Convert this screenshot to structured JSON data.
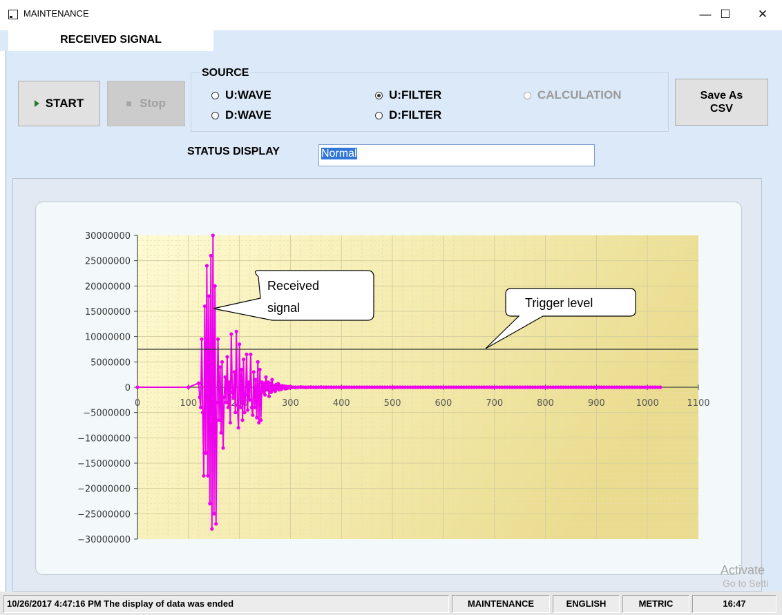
{
  "window": {
    "title": "MAINTENANCE",
    "minimize": "—",
    "maximize": "☐",
    "close": "✕"
  },
  "tabs": [
    {
      "label": "RECEIVED SIGNAL",
      "active": true
    }
  ],
  "toolbar": {
    "start_label": "START",
    "stop_label": "Stop",
    "save_line1": "Save As",
    "save_line2": "CSV"
  },
  "source": {
    "legend": "SOURCE",
    "options": [
      {
        "label": "U:WAVE",
        "checked": false,
        "enabled": true
      },
      {
        "label": "U:FILTER",
        "checked": true,
        "enabled": true
      },
      {
        "label": "CALCULATION",
        "checked": false,
        "enabled": false
      },
      {
        "label": "D:WAVE",
        "checked": false,
        "enabled": true
      },
      {
        "label": "D:FILTER",
        "checked": false,
        "enabled": true
      }
    ]
  },
  "status": {
    "label": "STATUS DISPLAY",
    "value": "Normal"
  },
  "chart_data": {
    "type": "scatter",
    "series": [
      {
        "color": "#ee00ee",
        "x": [
          0,
          100,
          120,
          122,
          124,
          126,
          128,
          130,
          132,
          134,
          136,
          138,
          140,
          142,
          144,
          146,
          148,
          150,
          152,
          154,
          156,
          158,
          160,
          162,
          164,
          166,
          168,
          170,
          172,
          174,
          176,
          178,
          180,
          182,
          184,
          186,
          188,
          190,
          192,
          194,
          196,
          198,
          200,
          202,
          204,
          206,
          208,
          210,
          212,
          214,
          216,
          218,
          220,
          222,
          224,
          226,
          228,
          230,
          232,
          234,
          236,
          238,
          240,
          242,
          244,
          246,
          248,
          250,
          252,
          254,
          256,
          258,
          260,
          262,
          264,
          266,
          268,
          270,
          272,
          274,
          276,
          278,
          280,
          282,
          284,
          286,
          288,
          290,
          292,
          294,
          296,
          298,
          300,
          310,
          320,
          330,
          340,
          350,
          360,
          370,
          380,
          390,
          400,
          410,
          500,
          1025
        ],
        "y": [
          0,
          0,
          800000,
          -2000000,
          -4000000,
          9500000,
          -5000000,
          -17500000,
          16000000,
          -13000000,
          24000000,
          -17500000,
          18000000,
          -23000000,
          26000000,
          -28000000,
          30000000,
          -25000000,
          20000000,
          -27000000,
          -3000000,
          9500000,
          -6500000,
          4000000,
          -9000000,
          5000000,
          -12000000,
          -2000000,
          2000000,
          -3000000,
          6000000,
          -4000000,
          1000000,
          -7000000,
          10500000,
          -1000000,
          -2000000,
          3000000,
          -5000000,
          11000000,
          -3500000,
          -8000000,
          8500000,
          -4000000,
          3500000,
          -6500000,
          5500000,
          -5000000,
          -1500000,
          6500000,
          -4500000,
          1000000,
          -2500000,
          6500000,
          -4000000,
          -5500000,
          3000000,
          -4000000,
          1500000,
          -6000000,
          5000000,
          -7000000,
          3500000,
          -6500000,
          1000000,
          -1000000,
          800000,
          -1500000,
          2000000,
          -500000,
          1000000,
          -1800000,
          800000,
          -1000000,
          1500000,
          -500000,
          300000,
          -800000,
          500000,
          -300000,
          700000,
          -500000,
          200000,
          -400000,
          300000,
          -100000,
          200000,
          -300000,
          150000,
          -200000,
          100000,
          -100000,
          100000,
          -80000,
          60000,
          -50000,
          40000,
          -20000,
          30000,
          -15000,
          10000,
          -8000,
          5000,
          -3000,
          0,
          0
        ]
      }
    ],
    "xlim": [
      0,
      1100
    ],
    "ylim": [
      -30000000,
      30000000
    ],
    "xticks": [
      "0",
      "100",
      "200",
      "300",
      "400",
      "500",
      "600",
      "700",
      "800",
      "900",
      "1000",
      "1100"
    ],
    "yticks": [
      "30000000",
      "25000000",
      "20000000",
      "15000000",
      "10000000",
      "5000000",
      "0",
      "−5000000",
      "−10000000",
      "−15000000",
      "−20000000",
      "−25000000",
      "−30000000"
    ],
    "trigger_level": 7500000,
    "grid": true,
    "annotations": [
      "Received",
      "signal",
      "Trigger level"
    ]
  },
  "watermark": {
    "line1": "Activate",
    "line2": "Go to Setti"
  },
  "statusbar": {
    "message": "10/26/2017 4:47:16 PM The display of data was ended",
    "mode": "MAINTENANCE",
    "language": "ENGLISH",
    "units": "METRIC",
    "time": "16:47"
  }
}
